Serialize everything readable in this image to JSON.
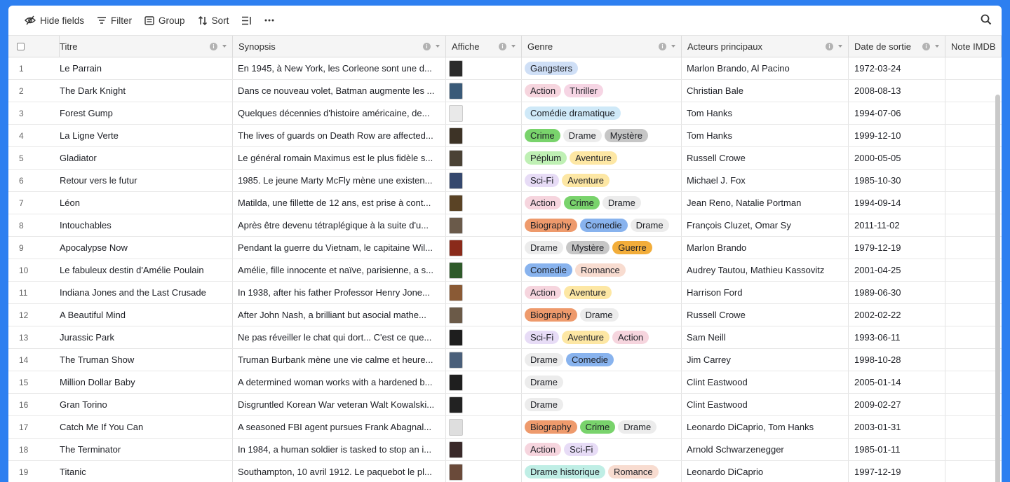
{
  "toolbar": {
    "hide_fields": "Hide fields",
    "filter": "Filter",
    "group": "Group",
    "sort": "Sort"
  },
  "columns": {
    "title": "Titre",
    "synopsis": "Synopsis",
    "affiche": "Affiche",
    "genre": "Genre",
    "acteurs": "Acteurs principaux",
    "date": "Date de sortie",
    "note": "Note IMDB"
  },
  "tag_colors": {
    "Gangsters": "#cfdff6",
    "Action": "#f6d5de",
    "Thriller": "#f6d5e4",
    "Comédie dramatique": "#cfe9f8",
    "Crime": "#79d36c",
    "Drame": "#ececec",
    "Mystère": "#c6c6c6",
    "Péplum": "#bff0b4",
    "Aventure": "#fde7a4",
    "Sci-Fi": "#e7dcf6",
    "Biography": "#ee9a6c",
    "Comedie": "#88b3ee",
    "Guerre": "#f2ad3a",
    "Romance": "#f8dcd0",
    "Drame historique": "#bfeee5"
  },
  "rows": [
    {
      "n": "1",
      "title": "Le Parrain",
      "synopsis": "En 1945, à New York, les Corleone sont une d...",
      "poster": "#2b2b2b",
      "genres": [
        "Gangsters"
      ],
      "actors": "Marlon Brando, Al Pacino",
      "date": "1972-03-24"
    },
    {
      "n": "2",
      "title": "The Dark Knight",
      "synopsis": "Dans ce nouveau volet, Batman augmente les ...",
      "poster": "#3a5a78",
      "genres": [
        "Action",
        "Thriller"
      ],
      "actors": "Christian Bale",
      "date": "2008-08-13"
    },
    {
      "n": "3",
      "title": "Forest Gump",
      "synopsis": "Quelques décennies d'histoire américaine, de...",
      "poster": "#e9e9e9",
      "genres": [
        "Comédie dramatique"
      ],
      "actors": "Tom Hanks",
      "date": "1994-07-06"
    },
    {
      "n": "4",
      "title": "La Ligne Verte",
      "synopsis": "The lives of guards on Death Row are affected...",
      "poster": "#3d3326",
      "genres": [
        "Crime",
        "Drame",
        "Mystère"
      ],
      "actors": "Tom Hanks",
      "date": "1999-12-10"
    },
    {
      "n": "5",
      "title": "Gladiator",
      "synopsis": "Le général romain Maximus est le plus fidèle s...",
      "poster": "#4a4235",
      "genres": [
        "Péplum",
        "Aventure"
      ],
      "actors": "Russell Crowe",
      "date": "2000-05-05"
    },
    {
      "n": "6",
      "title": "Retour vers le futur",
      "synopsis": "1985. Le jeune Marty McFly mène une existen...",
      "poster": "#35486e",
      "genres": [
        "Sci-Fi",
        "Aventure"
      ],
      "actors": "Michael J. Fox",
      "date": "1985-10-30"
    },
    {
      "n": "7",
      "title": "Léon",
      "synopsis": "Matilda, une fillette de 12 ans, est prise à cont...",
      "poster": "#5a4325",
      "genres": [
        "Action",
        "Crime",
        "Drame"
      ],
      "actors": "Jean Reno, Natalie Portman",
      "date": "1994-09-14"
    },
    {
      "n": "8",
      "title": "Intouchables",
      "synopsis": "Après être devenu tétraplégique à la suite d'u...",
      "poster": "#6a5a4a",
      "genres": [
        "Biography",
        "Comedie",
        "Drame"
      ],
      "actors": "François Cluzet, Omar Sy",
      "date": "2011-11-02"
    },
    {
      "n": "9",
      "title": "Apocalypse Now",
      "synopsis": "Pendant la guerre du Vietnam, le capitaine Wil...",
      "poster": "#8a2a1a",
      "genres": [
        "Drame",
        "Mystère",
        "Guerre"
      ],
      "actors": "Marlon Brando",
      "date": "1979-12-19"
    },
    {
      "n": "10",
      "title": "Le fabuleux destin d'Amélie Poulain",
      "synopsis": "Amélie, fille innocente et naïve, parisienne, a s...",
      "poster": "#2f5a2a",
      "genres": [
        "Comedie",
        "Romance"
      ],
      "actors": "Audrey Tautou, Mathieu Kassovitz",
      "date": "2001-04-25"
    },
    {
      "n": "11",
      "title": "Indiana Jones and the Last Crusade",
      "synopsis": "In 1938, after his father Professor Henry Jone...",
      "poster": "#8a5a35",
      "genres": [
        "Action",
        "Aventure"
      ],
      "actors": "Harrison Ford",
      "date": "1989-06-30"
    },
    {
      "n": "12",
      "title": "A Beautiful Mind",
      "synopsis": "After John Nash, a brilliant but asocial mathe...",
      "poster": "#6b5a48",
      "genres": [
        "Biography",
        "Drame"
      ],
      "actors": "Russell Crowe",
      "date": "2002-02-22"
    },
    {
      "n": "13",
      "title": "Jurassic Park",
      "synopsis": "Ne pas réveiller le chat qui dort... C'est ce que...",
      "poster": "#1e1e1e",
      "genres": [
        "Sci-Fi",
        "Aventure",
        "Action"
      ],
      "actors": "Sam Neill",
      "date": "1993-06-11"
    },
    {
      "n": "14",
      "title": "The Truman Show",
      "synopsis": "Truman Burbank mène une vie calme et heure...",
      "poster": "#4a5f7a",
      "genres": [
        "Drame",
        "Comedie"
      ],
      "actors": "Jim Carrey",
      "date": "1998-10-28"
    },
    {
      "n": "15",
      "title": "Million Dollar Baby",
      "synopsis": "A determined woman works with a hardened b...",
      "poster": "#1f1f1f",
      "genres": [
        "Drame"
      ],
      "actors": "Clint Eastwood",
      "date": "2005-01-14"
    },
    {
      "n": "16",
      "title": "Gran Torino",
      "synopsis": "Disgruntled Korean War veteran Walt Kowalski...",
      "poster": "#222222",
      "genres": [
        "Drame"
      ],
      "actors": "Clint Eastwood",
      "date": "2009-02-27"
    },
    {
      "n": "17",
      "title": "Catch Me If You Can",
      "synopsis": "A seasoned FBI agent pursues Frank Abagnal...",
      "poster": "#dedede",
      "genres": [
        "Biography",
        "Crime",
        "Drame"
      ],
      "actors": "Leonardo DiCaprio, Tom Hanks",
      "date": "2003-01-31"
    },
    {
      "n": "18",
      "title": "The Terminator",
      "synopsis": "In 1984, a human soldier is tasked to stop an i...",
      "poster": "#3a2a2a",
      "genres": [
        "Action",
        "Sci-Fi"
      ],
      "actors": "Arnold Schwarzenegger",
      "date": "1985-01-11"
    },
    {
      "n": "19",
      "title": "Titanic",
      "synopsis": "Southampton, 10 avril 1912. Le paquebot le pl...",
      "poster": "#6a4a3a",
      "genres": [
        "Drame historique",
        "Romance"
      ],
      "actors": "Leonardo DiCaprio",
      "date": "1997-12-19"
    }
  ]
}
